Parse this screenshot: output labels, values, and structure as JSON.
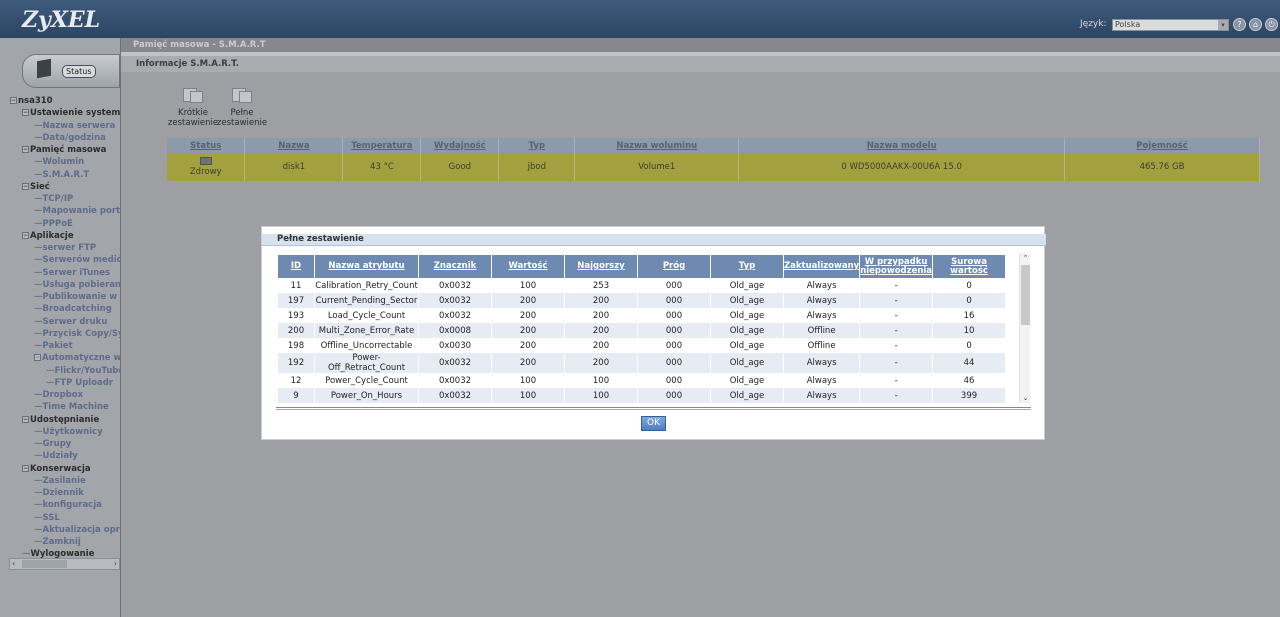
{
  "header": {
    "logo": "ZyXEL",
    "language_label": "Język:",
    "language_value": "Polska"
  },
  "status_tab": {
    "label": "Status"
  },
  "tree": [
    {
      "label": "nsa310",
      "level": 0,
      "kind": "top",
      "exp": "−"
    },
    {
      "label": "Ustawienie systemu",
      "level": 1,
      "kind": "top",
      "exp": "−"
    },
    {
      "label": "Nazwa serwera",
      "level": 2,
      "kind": "sub"
    },
    {
      "label": "Data/godzina",
      "level": 2,
      "kind": "sub"
    },
    {
      "label": "Pamięć masowa",
      "level": 1,
      "kind": "top",
      "exp": "−"
    },
    {
      "label": "Wolumin",
      "level": 2,
      "kind": "sub"
    },
    {
      "label": "S.M.A.R.T",
      "level": 2,
      "kind": "sub"
    },
    {
      "label": "Sieć",
      "level": 1,
      "kind": "top",
      "exp": "−"
    },
    {
      "label": "TCP/IP",
      "level": 2,
      "kind": "sub"
    },
    {
      "label": "Mapowanie portów",
      "level": 2,
      "kind": "sub"
    },
    {
      "label": "PPPoE",
      "level": 2,
      "kind": "sub"
    },
    {
      "label": "Aplikacje",
      "level": 1,
      "kind": "top",
      "exp": "−"
    },
    {
      "label": "serwer FTP",
      "level": 2,
      "kind": "sub"
    },
    {
      "label": "Serwerów mediów",
      "level": 2,
      "kind": "sub"
    },
    {
      "label": "Serwer iTunes",
      "level": 2,
      "kind": "sub"
    },
    {
      "label": "Usługa pobierania",
      "level": 2,
      "kind": "sub"
    },
    {
      "label": "Publikowanie w sieci",
      "level": 2,
      "kind": "sub"
    },
    {
      "label": "Broadcatching",
      "level": 2,
      "kind": "sub"
    },
    {
      "label": "Serwer druku",
      "level": 2,
      "kind": "sub"
    },
    {
      "label": "Przycisk Copy/Sync",
      "level": 2,
      "kind": "sub"
    },
    {
      "label": "Pakiet",
      "level": 2,
      "kind": "sub"
    },
    {
      "label": "Automatyczne wysyłanie",
      "level": 2,
      "kind": "sub",
      "exp": "−"
    },
    {
      "label": "Flickr/YouTube",
      "level": 3,
      "kind": "sub"
    },
    {
      "label": "FTP Uploadr",
      "level": 3,
      "kind": "sub"
    },
    {
      "label": "Dropbox",
      "level": 2,
      "kind": "sub"
    },
    {
      "label": "Time Machine",
      "level": 2,
      "kind": "sub"
    },
    {
      "label": "Udostępnianie",
      "level": 1,
      "kind": "top",
      "exp": "−"
    },
    {
      "label": "Użytkownicy",
      "level": 2,
      "kind": "sub"
    },
    {
      "label": "Grupy",
      "level": 2,
      "kind": "sub"
    },
    {
      "label": "Udziały",
      "level": 2,
      "kind": "sub"
    },
    {
      "label": "Konserwacja",
      "level": 1,
      "kind": "top",
      "exp": "−"
    },
    {
      "label": "Zasilanie",
      "level": 2,
      "kind": "sub"
    },
    {
      "label": "Dziennik",
      "level": 2,
      "kind": "sub"
    },
    {
      "label": "konfiguracja",
      "level": 2,
      "kind": "sub"
    },
    {
      "label": "SSL",
      "level": 2,
      "kind": "sub"
    },
    {
      "label": "Aktualizacja oprogramowania",
      "level": 2,
      "kind": "sub"
    },
    {
      "label": "Zamknij",
      "level": 2,
      "kind": "sub"
    },
    {
      "label": "Wylogowanie",
      "level": 1,
      "kind": "top"
    }
  ],
  "breadcrumb": "Pamięć masowa - S.M.A.R.T",
  "subheader": "Informacje S.M.A.R.T.",
  "toolbar": {
    "short_line1": "Krótkie",
    "short_line2": "zestawienie",
    "full_line1": "Pełne",
    "full_line2": "zestawienie"
  },
  "disk_table": {
    "headers": [
      "Status",
      "Nazwa",
      "Temperatura",
      "Wydajność",
      "Typ",
      "Nazwa woluminu",
      "Nazwa modelu",
      "Pojemność"
    ],
    "row": {
      "status": "Zdrowy",
      "name": "disk1",
      "temp": "43 °C",
      "perf": "Good",
      "type": "jbod",
      "volume": "Volume1",
      "model": "0 WD5000AAKX-00U6A 15.0",
      "capacity": "465.76 GB"
    }
  },
  "modal": {
    "title": "Pełne zestawienie",
    "headers": [
      "ID",
      "Nazwa atrybutu",
      "Znacznik",
      "Wartość",
      "Najgorszy",
      "Próg",
      "Typ",
      "Zaktualizowany",
      "W przypadku niepowodzenia",
      "Surowa wartość"
    ],
    "rows": [
      [
        "11",
        "Calibration_Retry_Count",
        "0x0032",
        "100",
        "253",
        "000",
        "Old_age",
        "Always",
        "-",
        "0"
      ],
      [
        "197",
        "Current_Pending_Sector",
        "0x0032",
        "200",
        "200",
        "000",
        "Old_age",
        "Always",
        "-",
        "0"
      ],
      [
        "193",
        "Load_Cycle_Count",
        "0x0032",
        "200",
        "200",
        "000",
        "Old_age",
        "Always",
        "-",
        "16"
      ],
      [
        "200",
        "Multi_Zone_Error_Rate",
        "0x0008",
        "200",
        "200",
        "000",
        "Old_age",
        "Offline",
        "-",
        "10"
      ],
      [
        "198",
        "Offline_Uncorrectable",
        "0x0030",
        "200",
        "200",
        "000",
        "Old_age",
        "Offline",
        "-",
        "0"
      ],
      [
        "192",
        "Power-Off_Retract_Count",
        "0x0032",
        "200",
        "200",
        "000",
        "Old_age",
        "Always",
        "-",
        "44"
      ],
      [
        "12",
        "Power_Cycle_Count",
        "0x0032",
        "100",
        "100",
        "000",
        "Old_age",
        "Always",
        "-",
        "46"
      ],
      [
        "9",
        "Power_On_Hours",
        "0x0032",
        "100",
        "100",
        "000",
        "Old_age",
        "Always",
        "-",
        "399"
      ]
    ],
    "ok_label": "OK"
  }
}
